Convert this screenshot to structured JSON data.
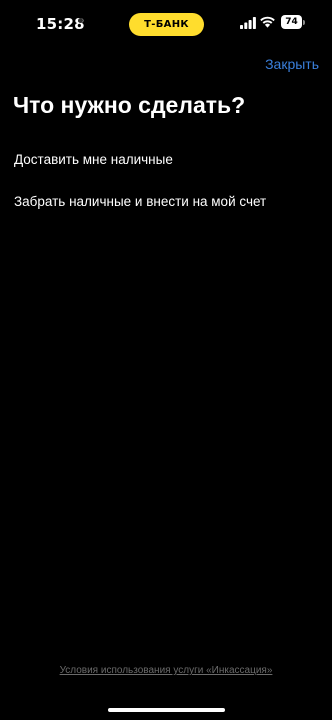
{
  "status_bar": {
    "time": "15:28",
    "carrier_badge": "Т-БАНК",
    "battery_level": "74",
    "battery_percent": 74,
    "badge_color": "#ffdd2d",
    "icons": [
      "signal-icon",
      "wifi-icon",
      "battery-icon"
    ]
  },
  "header": {
    "close_label": "Закрыть",
    "accent_color": "#3a7fdb"
  },
  "main": {
    "title": "Что нужно сделать?",
    "options": [
      {
        "label": "Доставить мне наличные"
      },
      {
        "label": "Забрать наличные и внести на мой счет"
      }
    ]
  },
  "footer": {
    "terms_label": "Условия использования услуги «Инкассация»"
  }
}
